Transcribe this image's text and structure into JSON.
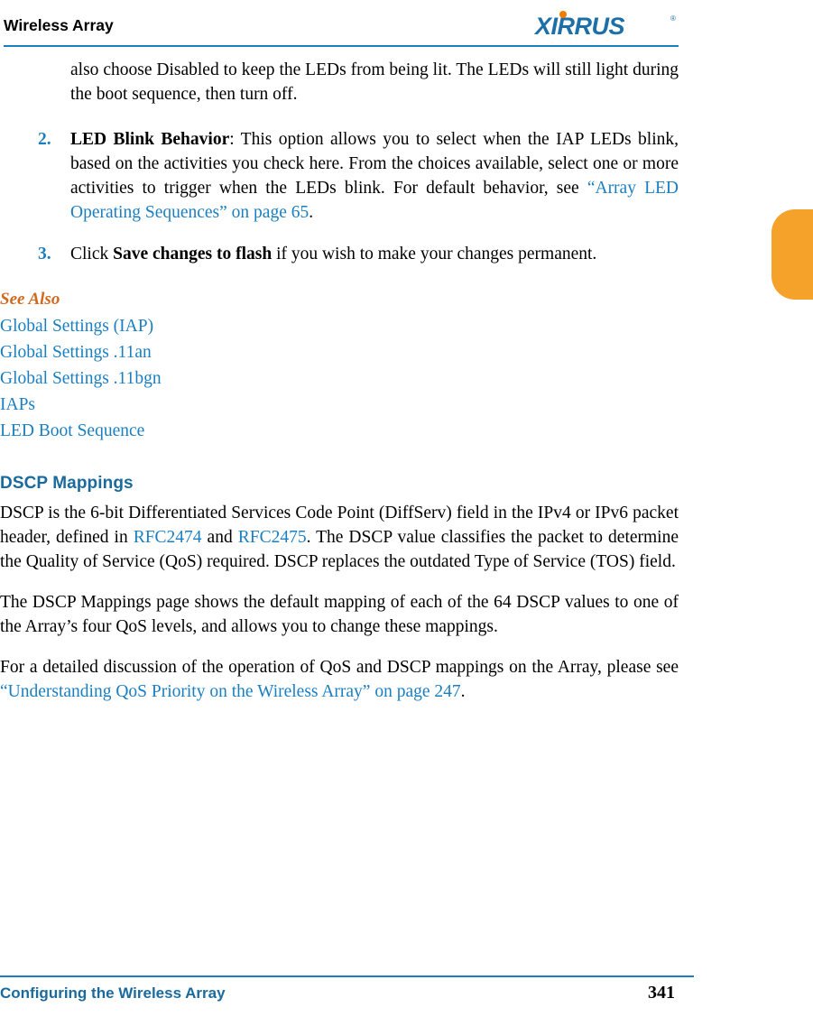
{
  "header": {
    "title": "Wireless Array",
    "logo_text": "XIRRUS",
    "logo_reg": "®"
  },
  "body": {
    "continued_paragraph": "also choose Disabled to keep the LEDs from being lit. The LEDs will still light during the boot sequence, then turn off.",
    "items": [
      {
        "number": "2.",
        "title": "LED Blink Behavior",
        "text_before": ": This option allows you to select when the IAP LEDs blink, based on the activities you check here. From the choices available, select one or more activities to trigger when the LEDs blink. For default behavior, see ",
        "link": "“Array LED Operating Sequences” on page 65",
        "text_after": "."
      },
      {
        "number": "3.",
        "lead": "Click ",
        "bold": "Save changes to flash",
        "tail": " if you wish to make your changes permanent."
      }
    ],
    "see_also_heading": "See Also",
    "see_also_items": [
      "Global Settings (IAP)",
      "Global Settings .11an",
      "Global Settings .11bgn",
      "IAPs",
      "LED Boot Sequence"
    ],
    "section_heading": "DSCP Mappings",
    "para1_part1": "DSCP is the 6-bit Differentiated Services Code Point (DiffServ) field in the IPv4 or IPv6 packet header, defined in ",
    "para1_link1": "RFC2474",
    "para1_part2": " and ",
    "para1_link2": "RFC2475",
    "para1_part3": ". The DSCP value classifies the packet to determine the Quality of Service (QoS) required. DSCP replaces the outdated Type of Service (TOS) field.",
    "para2": "The DSCP Mappings page shows the default mapping of each of the 64 DSCP values to one of the Array’s four QoS levels, and allows you to change these mappings.",
    "para3_part1": "For a detailed discussion of the operation of QoS and DSCP mappings on the Array, please see ",
    "para3_link": "“Understanding QoS Priority on the Wireless Array” on page 247",
    "para3_part2": "."
  },
  "footer": {
    "left": "Configuring the Wireless Array",
    "page_number": "341"
  }
}
